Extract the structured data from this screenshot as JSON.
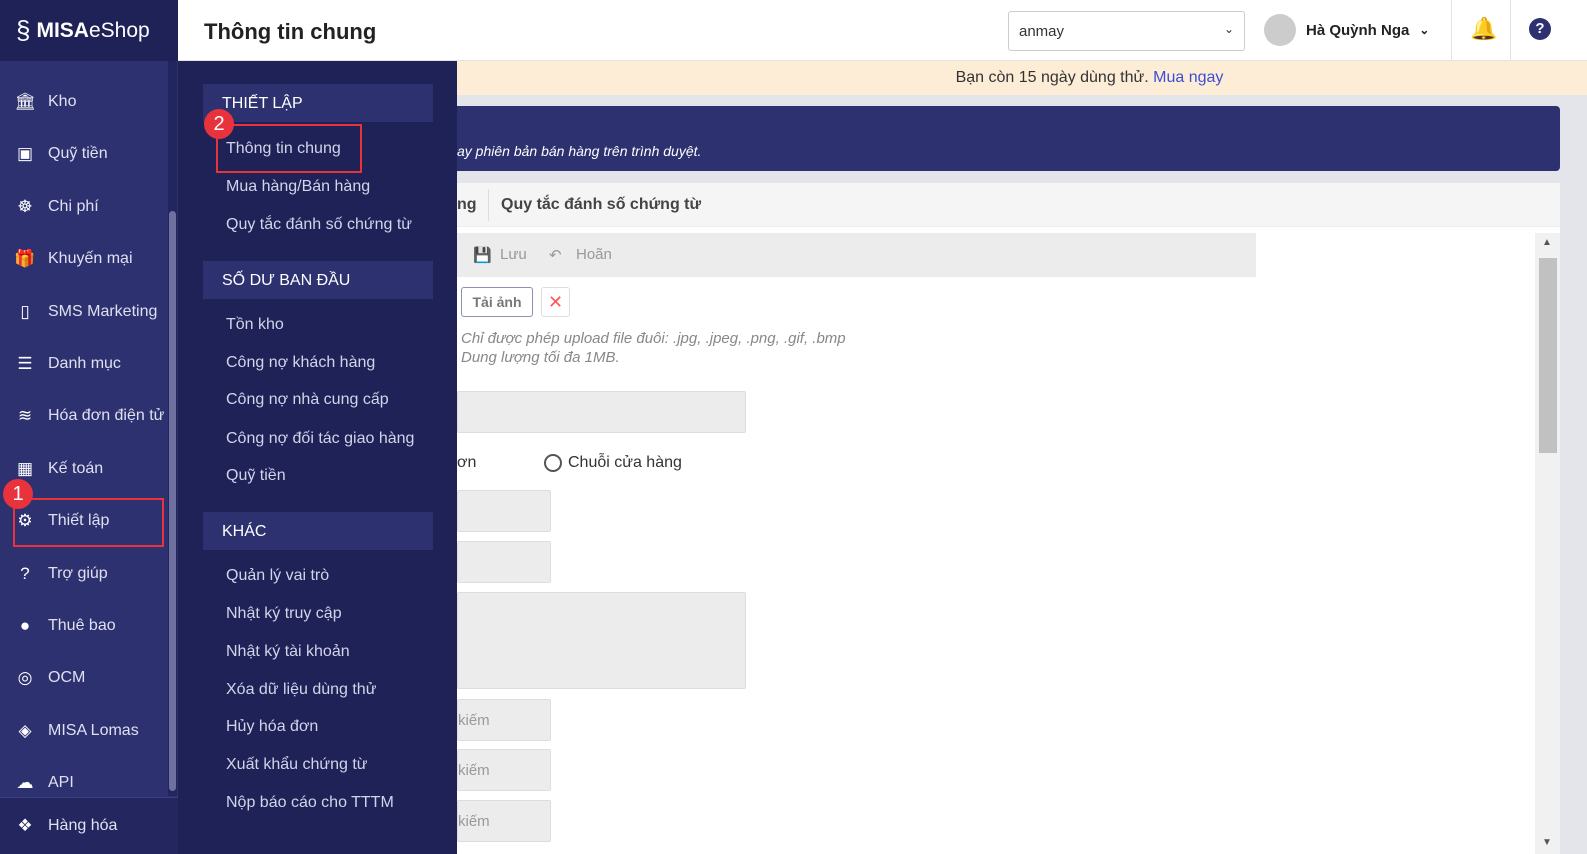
{
  "logo": {
    "brand": "MISA",
    "product": "eShop"
  },
  "header": {
    "title": "Thông tin chung",
    "store": "anmay",
    "user": "Hà Quỳnh Nga"
  },
  "sidebar": {
    "items": [
      {
        "label": "Kho",
        "icon": "bank-icon",
        "glyph": "🏛"
      },
      {
        "label": "Quỹ tiền",
        "icon": "safe-icon",
        "glyph": "▣"
      },
      {
        "label": "Chi phí",
        "icon": "money-icon",
        "glyph": "☸"
      },
      {
        "label": "Khuyến mại",
        "icon": "gift-icon",
        "glyph": "🎁"
      },
      {
        "label": "SMS Marketing",
        "icon": "phone-icon",
        "glyph": "▯"
      },
      {
        "label": "Danh mục",
        "icon": "list-icon",
        "glyph": "☰"
      },
      {
        "label": "Hóa đơn điện tử",
        "icon": "invoice-icon",
        "glyph": "≋"
      },
      {
        "label": "Kế toán",
        "icon": "calculator-icon",
        "glyph": "▦"
      },
      {
        "label": "Thiết lập",
        "icon": "gear-icon",
        "glyph": "⚙"
      },
      {
        "label": "Trợ giúp",
        "icon": "help-icon",
        "glyph": "?"
      },
      {
        "label": "Thuê bao",
        "icon": "user-icon",
        "glyph": "●"
      },
      {
        "label": "OCM",
        "icon": "ocm-icon",
        "glyph": "◎"
      },
      {
        "label": "MISA Lomas",
        "icon": "layers-icon",
        "glyph": "◈"
      },
      {
        "label": "API",
        "icon": "cloud-icon",
        "glyph": "☁"
      }
    ],
    "bottom": {
      "label": "Hàng hóa",
      "glyph": "❖"
    }
  },
  "submenu": {
    "sections": [
      {
        "title": "THIẾT LẬP",
        "items": [
          "Thông tin chung",
          "Mua hàng/Bán hàng",
          "Quy tắc đánh số chứng từ"
        ]
      },
      {
        "title": "SỐ DƯ BAN ĐẦU",
        "items": [
          "Tồn kho",
          "Công nợ khách hàng",
          "Công nợ nhà cung cấp",
          "Công nợ đối tác giao hàng",
          "Quỹ tiền"
        ]
      },
      {
        "title": "KHÁC",
        "items": [
          "Quản lý vai trò",
          "Nhật ký truy cập",
          "Nhật ký tài khoản",
          "Xóa dữ liệu dùng thử",
          "Hủy hóa đơn",
          "Xuất khẩu chứng từ",
          "Nộp báo cáo cho TTTM"
        ]
      }
    ]
  },
  "trial": {
    "text": "Bạn còn 15 ngày dùng thử.",
    "link": "Mua ngay"
  },
  "banner": {
    "text": "ay phiên bản bán hàng trên trình duyệt."
  },
  "tabs": {
    "partial": "ng",
    "numbering": "Quy tắc đánh số chứng từ"
  },
  "toolbar": {
    "save": "Lưu",
    "undo": "Hoãn"
  },
  "upload": {
    "button": "Tải ảnh",
    "hint1": "Chỉ được phép upload file đuôi: .jpg, .jpeg, .png, .gif, .bmp",
    "hint2": "Dung lượng tối đa 1MB."
  },
  "form": {
    "radio1": "ơn",
    "radio2": "Chuỗi cửa hàng",
    "search_placeholder": "kiếm"
  },
  "callouts": [
    "1",
    "2"
  ]
}
